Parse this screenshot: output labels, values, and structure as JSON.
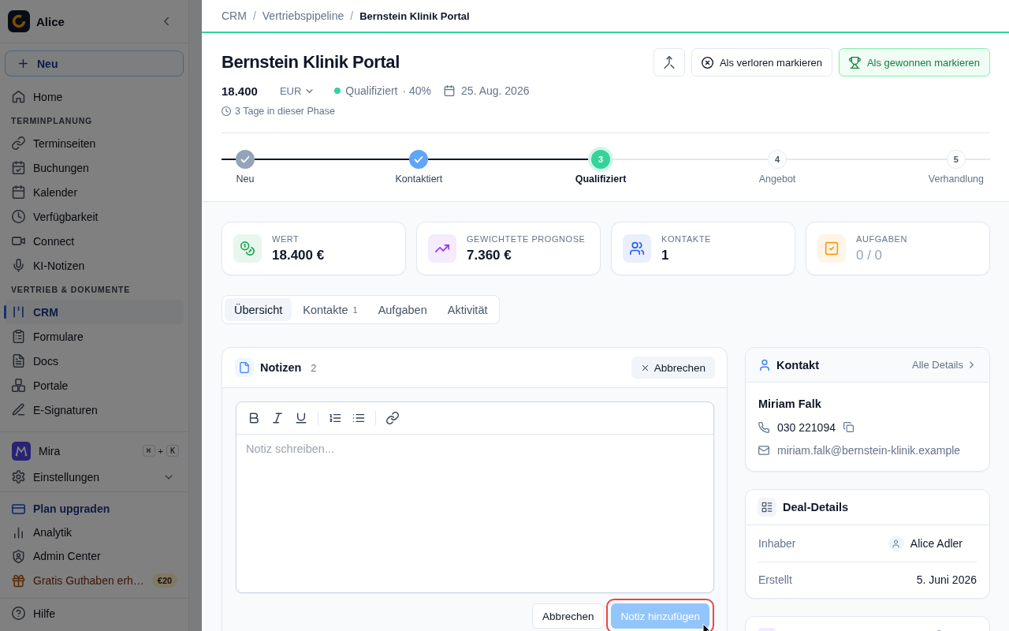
{
  "sidebar": {
    "workspace": "Alice",
    "new_button": "Neu",
    "groups": [
      {
        "items": [
          {
            "label": "Home",
            "selected": false
          }
        ]
      },
      {
        "heading": "TERMINPLANUNG",
        "items": [
          {
            "label": "Terminseiten",
            "selected": false
          },
          {
            "label": "Buchungen",
            "selected": false
          },
          {
            "label": "Kalender",
            "selected": false
          },
          {
            "label": "Verfügbarkeit",
            "selected": false
          },
          {
            "label": "Connect",
            "selected": false
          },
          {
            "label": "KI-Notizen",
            "selected": false
          }
        ]
      },
      {
        "heading": "VERTRIEB & DOKUMENTE",
        "items": [
          {
            "label": "CRM",
            "selected": true
          },
          {
            "label": "Formulare",
            "selected": false
          },
          {
            "label": "Docs",
            "selected": false
          },
          {
            "label": "Portale",
            "selected": false
          },
          {
            "label": "E-Signaturen",
            "selected": false
          }
        ]
      }
    ],
    "assistant": {
      "label": "Mira",
      "shortcut": [
        {
          "kind": "key",
          "text": "⌘"
        },
        {
          "kind": "plus",
          "text": "+"
        },
        {
          "kind": "key",
          "text": "K"
        }
      ]
    },
    "settings": {
      "label": "Einstellungen",
      "expanded": false
    },
    "footer": [
      {
        "kind": "upgrade",
        "label": "Plan upgraden"
      },
      {
        "kind": "link",
        "label": "Analytik"
      },
      {
        "kind": "link",
        "label": "Admin Center"
      },
      {
        "kind": "promo",
        "label": "Gratis Guthaben erh…",
        "badge": "€20"
      }
    ],
    "help": "Hilfe"
  },
  "breadcrumb": [
    {
      "kind": "link",
      "text": "CRM"
    },
    {
      "kind": "separator",
      "text": "/"
    },
    {
      "kind": "link",
      "text": "Vertriebspipeline"
    },
    {
      "kind": "separator",
      "text": "/"
    },
    {
      "kind": "current",
      "text": "Bernstein Klinik Portal"
    }
  ],
  "deal": {
    "title": "Bernstein Klinik Portal",
    "actions": [
      {
        "kind": "merge"
      },
      {
        "kind": "lost",
        "label": "Als verloren markieren"
      },
      {
        "kind": "won",
        "label": "Als gewonnen markieren"
      }
    ],
    "amount": "18.400",
    "currency": "EUR",
    "stage": "Qualifiziert",
    "probability": "· 40%",
    "close_date": "25. Aug. 2026",
    "time_in_stage": "3 Tage in dieser Phase"
  },
  "pipeline": [
    {
      "label": "Neu",
      "completed": true,
      "current": false,
      "color": "#94a3b8"
    },
    {
      "label": "Kontaktiert",
      "completed": true,
      "current": false,
      "color": "#60a5fa"
    },
    {
      "label": "Qualifiziert",
      "completed": false,
      "current": true,
      "number": "3",
      "color": "#34d399"
    },
    {
      "label": "Angebot",
      "completed": false,
      "current": false,
      "number": "4"
    },
    {
      "label": "Verhandlung",
      "completed": false,
      "current": false,
      "number": "5"
    }
  ],
  "stats": [
    {
      "label": "WERT",
      "value": "18.400 €",
      "color": "#e8f6ed",
      "muted": false
    },
    {
      "label": "GEWICHTETE PROGNOSE",
      "value": "7.360 €",
      "color": "#f4ebfd",
      "muted": false
    },
    {
      "label": "KONTAKTE",
      "value": "1",
      "color": "#e9effd",
      "muted": false
    },
    {
      "label": "AUFGABEN",
      "value": "0 / 0",
      "color": "#fef5e7",
      "muted": true
    }
  ],
  "tabs": [
    {
      "label": "Übersicht",
      "selected": true
    },
    {
      "label": "Kontakte",
      "count": "1",
      "selected": false
    },
    {
      "label": "Aufgaben",
      "selected": false
    },
    {
      "label": "Aktivität",
      "selected": false
    }
  ],
  "notes": {
    "title": "Notizen",
    "count": "2",
    "close_button": "Abbrechen",
    "toolbar": [
      {
        "kind": "bold"
      },
      {
        "kind": "italic"
      },
      {
        "kind": "underline"
      },
      {
        "kind": "separator"
      },
      {
        "kind": "ordered-list"
      },
      {
        "kind": "bullet-list"
      },
      {
        "kind": "separator"
      },
      {
        "kind": "link"
      }
    ],
    "placeholder": "Notiz schreiben...",
    "cancel": "Abbrechen",
    "submit": {
      "label": "Notiz hinzufügen",
      "disabled": true,
      "highlighted": true
    }
  },
  "side_panels": [
    {
      "kind": "contact",
      "title": "Kontakt",
      "link": "Alle Details",
      "name": "Miriam Falk",
      "phone": "030 221094",
      "email": "miriam.falk@bernstein-klinik.example"
    },
    {
      "kind": "details",
      "title": "Deal-Details",
      "rows": [
        {
          "kind": "person",
          "label": "Inhaber",
          "value": "Alice Adler"
        },
        {
          "kind": "text",
          "label": "Erstellt",
          "value": "5. Juni 2026"
        }
      ]
    },
    {
      "kind": "partial"
    }
  ]
}
